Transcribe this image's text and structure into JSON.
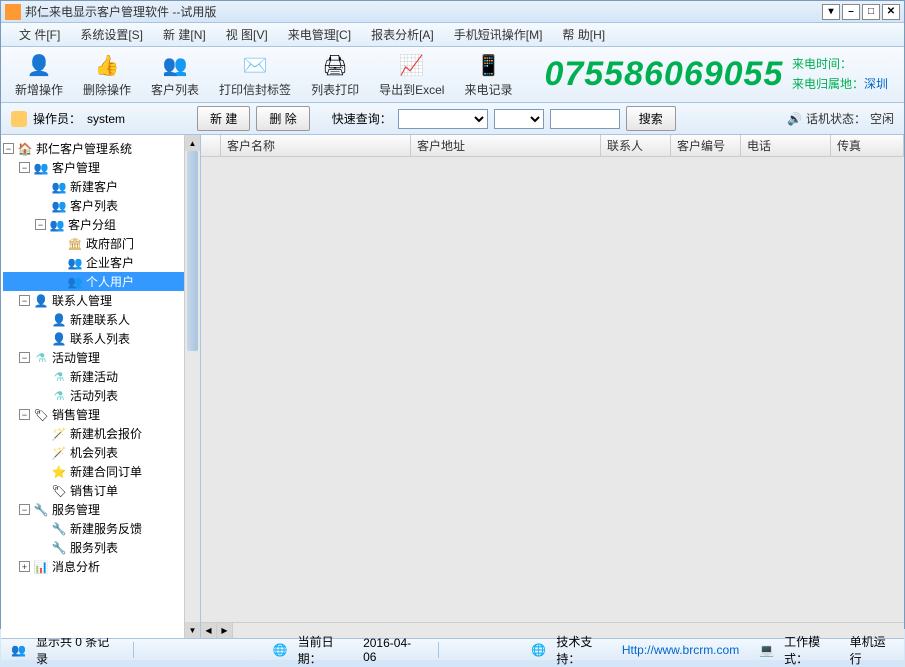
{
  "title": "邦仁来电显示客户管理软件 --试用版",
  "menubar": [
    "文 件[F]",
    "系统设置[S]",
    "新 建[N]",
    "视 图[V]",
    "来电管理[C]",
    "报表分析[A]",
    "手机短讯操作[M]",
    "帮 助[H]"
  ],
  "toolbar": [
    {
      "label": "新增操作",
      "icon": "👤"
    },
    {
      "label": "删除操作",
      "icon": "👍"
    },
    {
      "label": "客户列表",
      "icon": "👥"
    },
    {
      "label": "打印信封标签",
      "icon": "✉️"
    },
    {
      "label": "列表打印",
      "icon": "🖨"
    },
    {
      "label": "导出到Excel",
      "icon": "📈"
    },
    {
      "label": "来电记录",
      "icon": "📱"
    }
  ],
  "phone_number": "075586069055",
  "caller_time_label": "来电时间：",
  "caller_loc_label": "来电归属地：",
  "caller_loc_value": "深圳",
  "operator_label": "操作员：",
  "operator_value": "system",
  "btn_new": "新   建",
  "btn_del": "删   除",
  "quick_search_label": "快速查询：",
  "btn_search": "搜索",
  "phone_status_label": "话机状态：",
  "phone_status_value": "空闲",
  "tree": {
    "root": "邦仁客户管理系统",
    "groups": [
      {
        "label": "客户管理",
        "children": [
          "新建客户",
          "客户列表",
          {
            "label": "客户分组",
            "children": [
              "政府部门",
              "企业客户",
              "个人用户"
            ]
          }
        ]
      },
      {
        "label": "联系人管理",
        "children": [
          "新建联系人",
          "联系人列表"
        ]
      },
      {
        "label": "活动管理",
        "children": [
          "新建活动",
          "活动列表"
        ]
      },
      {
        "label": "销售管理",
        "children": [
          "新建机会报价",
          "机会列表",
          "新建合同订单",
          "销售订单"
        ]
      },
      {
        "label": "服务管理",
        "children": [
          "新建服务反馈",
          "服务列表"
        ]
      },
      {
        "label": "消息分析"
      }
    ],
    "selected": "个人用户"
  },
  "grid_columns": [
    "客户名称",
    "客户地址",
    "联系人",
    "客户编号",
    "电话",
    "传真"
  ],
  "status_records": "显示共 0 条记录",
  "status_date_label": "当前日期：",
  "status_date_value": "2016-04-06",
  "status_support_label": "技术支持：",
  "status_support_link": "Http://www.brcrm.com",
  "status_mode_label": "工作模式：",
  "status_mode_value": "单机运行"
}
